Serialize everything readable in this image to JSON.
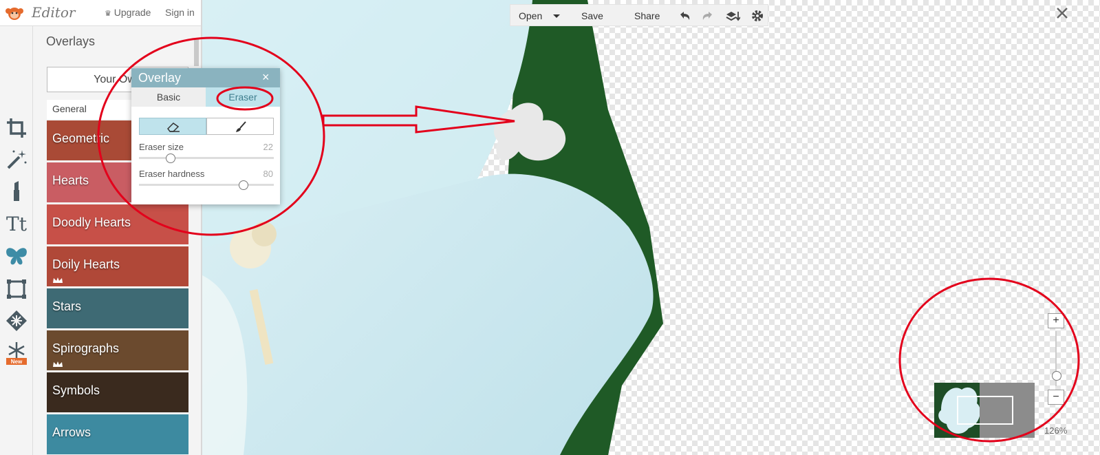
{
  "header": {
    "app_name": "Editor",
    "upgrade_label": "Upgrade",
    "signin_label": "Sign in"
  },
  "tools": [
    {
      "name": "crop-icon"
    },
    {
      "name": "magic-wand-icon"
    },
    {
      "name": "lipstick-icon"
    },
    {
      "name": "text-icon",
      "label": "Tt"
    },
    {
      "name": "butterfly-icon"
    },
    {
      "name": "frame-icon"
    },
    {
      "name": "texture-icon"
    },
    {
      "name": "snowflake-icon",
      "badge": "New"
    }
  ],
  "panel": {
    "title": "Overlays",
    "your_own_label": "Your Own",
    "category": "General",
    "items": [
      {
        "label": "Geometric",
        "color": "#a94a36"
      },
      {
        "label": "Hearts",
        "color": "#c95d63"
      },
      {
        "label": "Doodly Hearts",
        "color": "#c75048"
      },
      {
        "label": "Doily Hearts",
        "color": "#b04838"
      },
      {
        "label": "Stars",
        "color": "#3e6a74"
      },
      {
        "label": "Spirographs",
        "color": "#6b4a2e"
      },
      {
        "label": "Symbols",
        "color": "#3a2a1e"
      },
      {
        "label": "Arrows",
        "color": "#3d8aa0"
      }
    ]
  },
  "toolbar": {
    "open_label": "Open",
    "save_label": "Save",
    "share_label": "Share"
  },
  "dialog": {
    "title": "Overlay",
    "close": "×",
    "tabs": [
      "Basic",
      "Eraser"
    ],
    "eraser_size_label": "Eraser size",
    "eraser_size_value": "22",
    "eraser_hardness_label": "Eraser hardness",
    "eraser_hardness_value": "80"
  },
  "zoom": {
    "plus": "+",
    "minus": "−",
    "level": "126%"
  },
  "colors": {
    "annotation": "#e3001b",
    "accent": "#8ab3bf",
    "tab_active": "#bfe3ec"
  }
}
